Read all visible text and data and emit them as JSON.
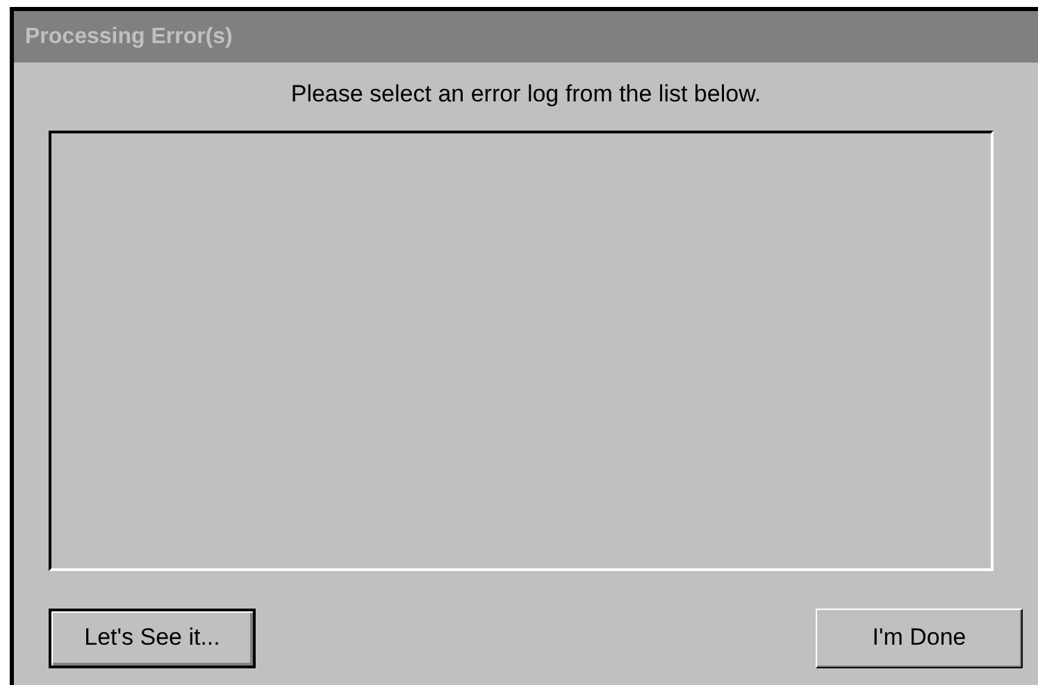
{
  "window": {
    "title": "Processing Error(s)",
    "active": false
  },
  "instruction": "Please select an error log from the list below.",
  "buttons": [
    {
      "label": "Let's See it...",
      "default": true
    },
    {
      "label": "I'm Done",
      "default": false
    }
  ]
}
